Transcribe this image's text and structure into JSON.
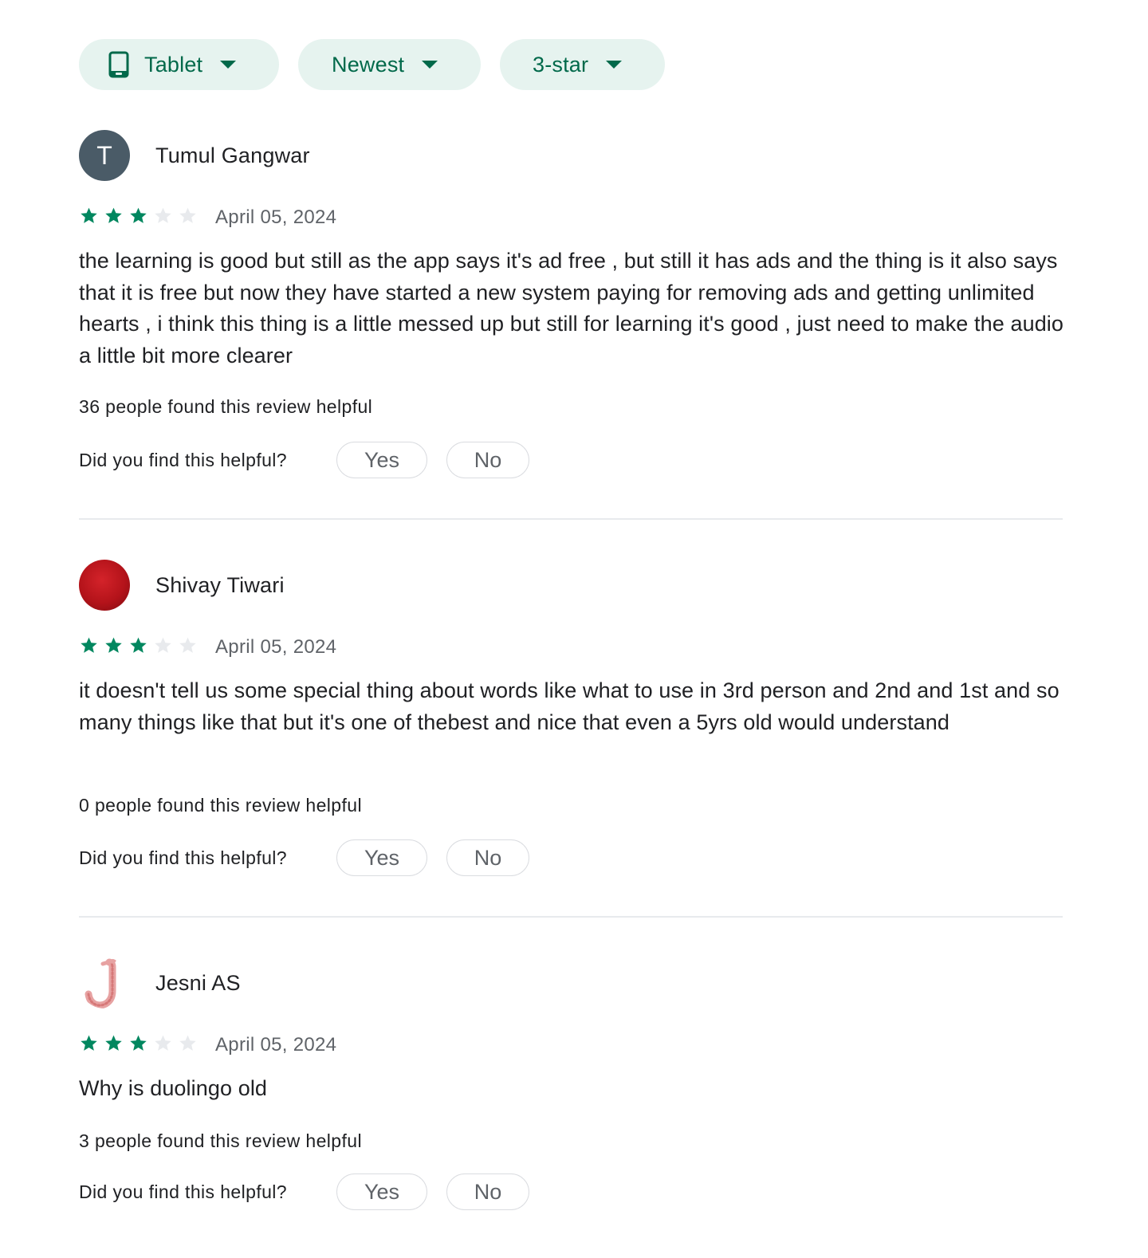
{
  "filters": {
    "device": {
      "label": "Tablet",
      "icon": "tablet-icon"
    },
    "sort": {
      "label": "Newest"
    },
    "rating": {
      "label": "3-star"
    }
  },
  "colors": {
    "accent": "#01694a",
    "chip_bg": "#e6f3ef",
    "star_filled": "#01875f",
    "star_empty": "#e8eaed"
  },
  "reviews": [
    {
      "avatar_letter": "T",
      "name": "Tumul Gangwar",
      "rating": 3,
      "max_rating": 5,
      "date": "April 05, 2024",
      "text": "the learning is good but still as the app says it's ad free , but still it has ads and the thing is it also says that it is free but now they have started a new system paying for removing ads and getting unlimited hearts , i think this thing is a little messed up but still for learning it's good , just need to make the audio a little bit more clearer",
      "helpful_count": "36 people found this review helpful",
      "helpful_question": "Did you find this helpful?",
      "yes_label": "Yes",
      "no_label": "No"
    },
    {
      "name": "Shivay Tiwari",
      "rating": 3,
      "max_rating": 5,
      "date": "April 05, 2024",
      "text": "it doesn't tell us some special thing about words like what to use in 3rd person and 2nd and 1st and so many things like that but it's one of thebest and nice that even a 5yrs old would understand",
      "helpful_count": "0 people found this review helpful",
      "helpful_question": "Did you find this helpful?",
      "yes_label": "Yes",
      "no_label": "No"
    },
    {
      "name": "Jesni AS",
      "rating": 3,
      "max_rating": 5,
      "date": "April 05, 2024",
      "text": "Why is duolingo old",
      "helpful_count": "3 people found this review helpful",
      "helpful_question": "Did you find this helpful?",
      "yes_label": "Yes",
      "no_label": "No"
    }
  ]
}
